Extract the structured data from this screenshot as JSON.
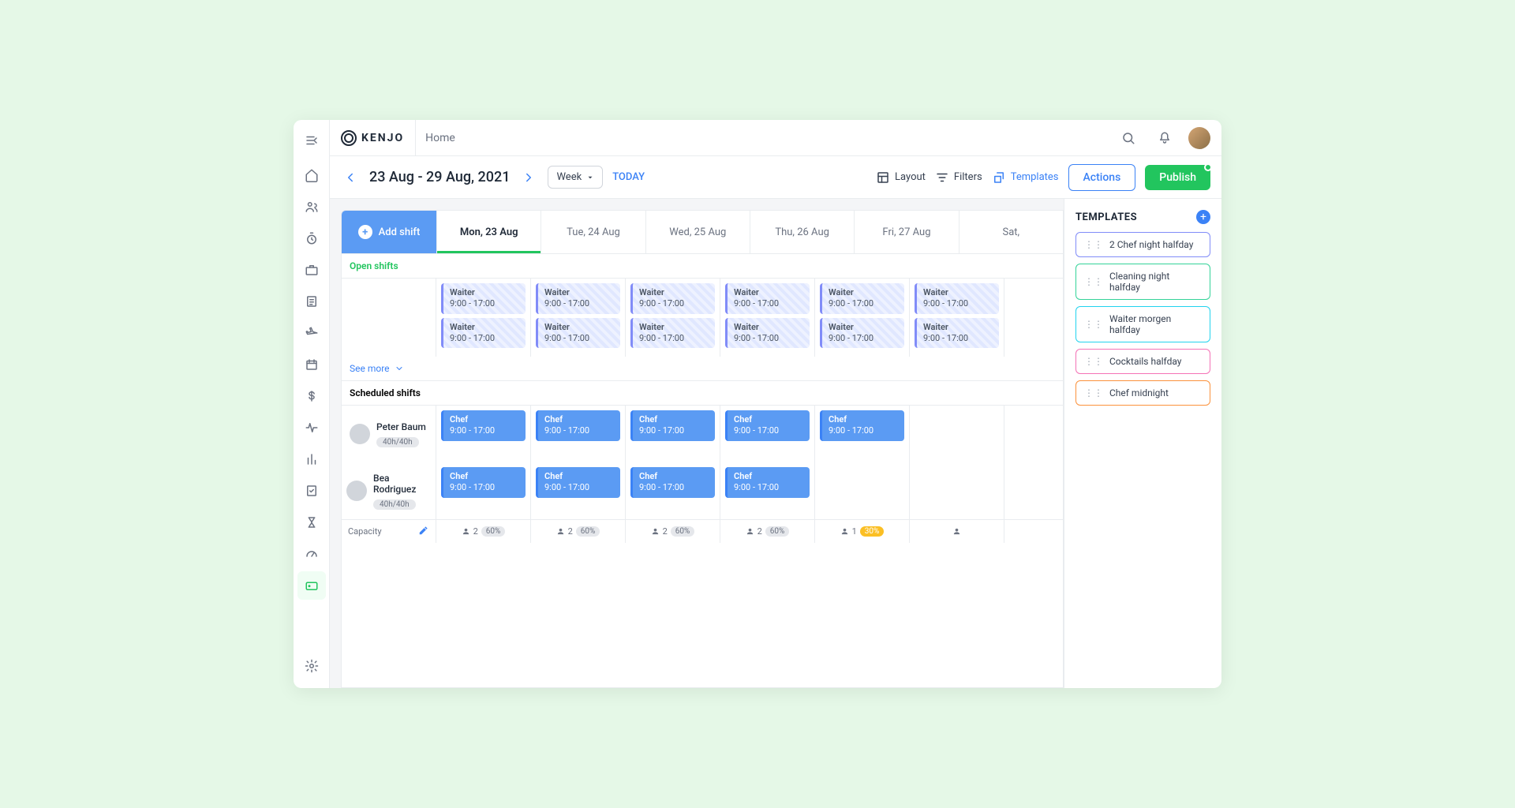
{
  "brand": "KENJO",
  "breadcrumb": "Home",
  "dateRange": "23 Aug - 29 Aug, 2021",
  "viewSelect": "Week",
  "todayLabel": "TODAY",
  "tools": {
    "layout": "Layout",
    "filters": "Filters",
    "templates": "Templates"
  },
  "actions": {
    "actions": "Actions",
    "publish": "Publish"
  },
  "addShift": "Add shift",
  "days": [
    "Mon, 23 Aug",
    "Tue, 24 Aug",
    "Wed, 25 Aug",
    "Thu, 26 Aug",
    "Fri, 27 Aug",
    "Sat,"
  ],
  "sections": {
    "open": "Open shifts",
    "scheduled": "Scheduled shifts",
    "seeMore": "See more",
    "capacity": "Capacity"
  },
  "openShift": {
    "role": "Waiter",
    "time": "9:00 - 17:00"
  },
  "chefShift": {
    "role": "Chef",
    "time": "9:00 - 17:00"
  },
  "people": [
    {
      "name": "Peter Baum",
      "hours": "40h/40h",
      "shifts": 5
    },
    {
      "name": "Bea Rodriguez",
      "hours": "40h/40h",
      "shifts": 4
    }
  ],
  "capacity": [
    {
      "count": "2",
      "pct": "60%",
      "warn": false
    },
    {
      "count": "2",
      "pct": "60%",
      "warn": false
    },
    {
      "count": "2",
      "pct": "60%",
      "warn": false
    },
    {
      "count": "2",
      "pct": "60%",
      "warn": false
    },
    {
      "count": "1",
      "pct": "30%",
      "warn": true
    }
  ],
  "panel": {
    "title": "TEMPLATES"
  },
  "templates": [
    {
      "label": "2 Chef night halfday",
      "color": "indigo"
    },
    {
      "label": "Cleaning night halfday",
      "color": "green"
    },
    {
      "label": "Waiter morgen halfday",
      "color": "cyan"
    },
    {
      "label": "Cocktails halfday",
      "color": "pink"
    },
    {
      "label": "Chef midnight",
      "color": "orange"
    }
  ]
}
